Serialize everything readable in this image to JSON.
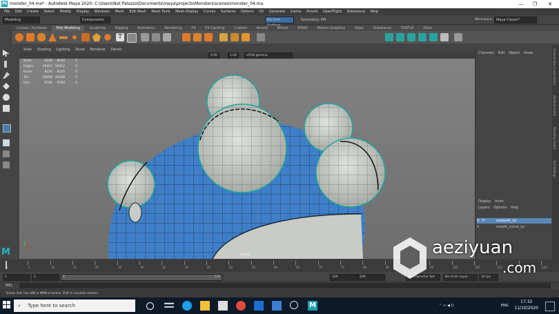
{
  "window": {
    "title": "monster_04.ma* - Autodesk Maya 2020: C:\\Users\\Nat Palazzo\\Documents\\maya\\projects\\Monsters\\scenes\\monster_04.ma",
    "app_icon": "M",
    "min": "—",
    "max": "❐",
    "close": "✕"
  },
  "menu": [
    "File",
    "Edit",
    "Create",
    "Select",
    "Modify",
    "Display",
    "Windows",
    "Mesh",
    "Edit Mesh",
    "Mesh Tools",
    "Mesh Display",
    "Curves",
    "Surfaces",
    "Deform",
    "UV",
    "Generate",
    "Cache",
    "Arnold",
    "OpenFlight",
    "Substance",
    "Help"
  ],
  "status": {
    "mode": "Modeling",
    "components": "Components",
    "live": "No Live Surface",
    "symmetry": "Symmetry: Off",
    "workspace_label": "Workspace:",
    "workspace": "Maya Classic*"
  },
  "shelf_tabs": [
    "Curves / Surfaces",
    "Poly Modeling",
    "Sculpting",
    "Rigging",
    "Animation",
    "Rendering",
    "FX",
    "FX Caching",
    "Custom",
    "Arnold",
    "Bifrost",
    "MASH",
    "Motion Graphics",
    "XGen",
    "Substance",
    "TURTLE",
    "XGen"
  ],
  "shelf_active": "Poly Modeling",
  "panel_menu": [
    "View",
    "Shading",
    "Lighting",
    "Show",
    "Renderer",
    "Panels"
  ],
  "panel_bar": {
    "near": "0.00",
    "far": "1.00",
    "colorspace": "sRGB gamma"
  },
  "hud": [
    {
      "label": "Verts:",
      "a": "8194",
      "b": "8194",
      "c": "0"
    },
    {
      "label": "Edges:",
      "a": "16412",
      "b": "16412",
      "c": "0"
    },
    {
      "label": "Faces:",
      "a": "8220",
      "b": "8220",
      "c": "0"
    },
    {
      "label": "Tris:",
      "a": "16298",
      "b": "16298",
      "c": "0"
    },
    {
      "label": "UVs:",
      "a": "9784",
      "b": "9784",
      "c": "0"
    }
  ],
  "persp_label": "persp",
  "channel_box": {
    "tabs": [
      "Channels",
      "Edit",
      "Object",
      "Show"
    ]
  },
  "layer_panel": {
    "tabs": [
      "Display",
      "Anim"
    ],
    "menu": [
      "Layers",
      "Options",
      "Help"
    ],
    "layers": [
      {
        "v": "V",
        "p": "P",
        "name": "eyeballs_lyr",
        "selected": true
      },
      {
        "v": "V",
        "p": "",
        "name": "mouth_curve_lyr",
        "selected": false
      }
    ]
  },
  "side_tabs": [
    "Channel Box / Layer Editor",
    "Attribute Editor",
    "Modeling Toolkit",
    "Tool Settings"
  ],
  "time_slider": {
    "ticks": [
      "1",
      "5",
      "10",
      "15",
      "20",
      "25",
      "30",
      "35",
      "40",
      "45",
      "50",
      "55",
      "60",
      "65",
      "70",
      "75",
      "80",
      "85",
      "90",
      "95",
      "100",
      "105",
      "110",
      "115",
      "120"
    ],
    "current": "1"
  },
  "range": {
    "start": "1",
    "start2": "1",
    "mid": "1",
    "end_inner": "120",
    "end": "120",
    "end2": "200",
    "character": "No Character Set",
    "anim_layer": "No Anim Layer",
    "fps": "24 fps"
  },
  "cmd": {
    "label": "MEL"
  },
  "help_line": "Tumble Tool: Use LMB or MMB to tumble. Shift to constrain rotation.",
  "taskbar": {
    "search": "Type here to search",
    "time": "17:32",
    "date": "11/10/2020",
    "lang": "ENG"
  },
  "watermark": {
    "main": "aeziyuan",
    "sub": ".com"
  },
  "colors": {
    "mesh_blue": "#3f7fc9",
    "mesh_white": "#c9ccc6",
    "wire": "#1a2a3a",
    "active_tab": "#5d5d5d",
    "selected_layer": "#5b87b5"
  }
}
